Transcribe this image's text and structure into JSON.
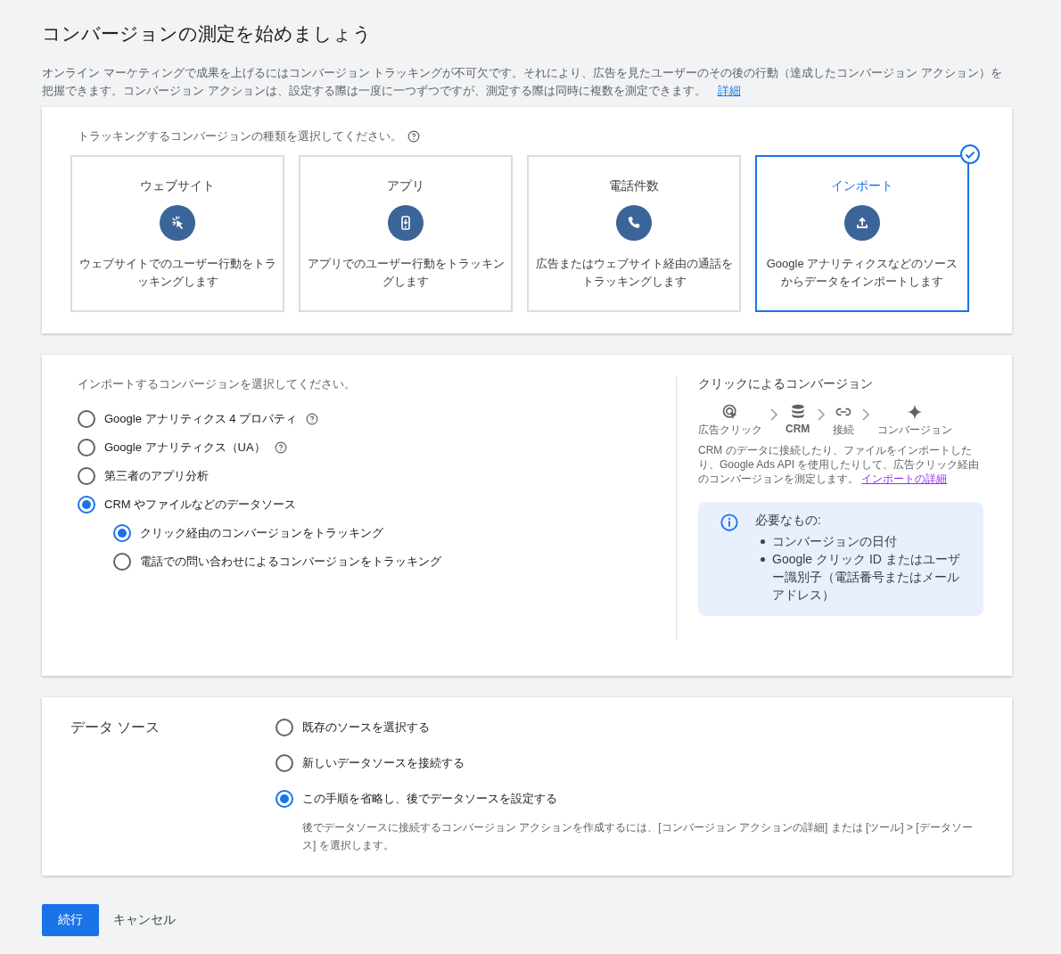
{
  "title": "コンバージョンの測定を始めましょう",
  "intro": {
    "text": "オンライン マーケティングで成果を上げるにはコンバージョン トラッキングが不可欠です。それにより、広告を見たユーザーのその後の行動（達成したコンバージョン アクション）を把握できます。コンバージョン アクションは、設定する際は一度に一つずつですが、測定する際は同時に複数を測定できます。",
    "link": "詳細"
  },
  "type_section": {
    "prompt": "トラッキングするコンバージョンの種類を選択してください。",
    "cards": [
      {
        "kind": "website",
        "title": "ウェブサイト",
        "description": "ウェブサイトでのユーザー行動をトラッキングします",
        "selected": false
      },
      {
        "kind": "app",
        "title": "アプリ",
        "description": "アプリでのユーザー行動をトラッキングします",
        "selected": false
      },
      {
        "kind": "phone",
        "title": "電話件数",
        "description": "広告またはウェブサイト経由の通話をトラッキングします",
        "selected": false
      },
      {
        "kind": "import",
        "title": "インポート",
        "description": "Google アナリティクスなどのソースからデータをインポートします",
        "selected": true
      }
    ]
  },
  "import_section": {
    "prompt": "インポートするコンバージョンを選択してください。",
    "options": [
      {
        "label": "Google アナリティクス 4 プロパティ",
        "help": true,
        "selected": false
      },
      {
        "label": "Google アナリティクス（UA）",
        "help": true,
        "selected": false
      },
      {
        "label": "第三者のアプリ分析",
        "help": false,
        "selected": false
      },
      {
        "label": "CRM やファイルなどのデータソース",
        "help": false,
        "selected": true,
        "children": [
          {
            "label": "クリック経由のコンバージョンをトラッキング",
            "help": false,
            "selected": true
          },
          {
            "label": "電話での問い合わせによるコンバージョンをトラッキング",
            "help": false,
            "selected": false
          }
        ]
      }
    ]
  },
  "flow": {
    "title": "クリックによるコンバージョン",
    "steps": [
      {
        "kind": "click",
        "label": "広告クリック"
      },
      {
        "kind": "database",
        "label": "CRM"
      },
      {
        "kind": "link",
        "label": "接続"
      },
      {
        "kind": "sparkle",
        "label": "コンバージョン"
      }
    ],
    "description": "CRM のデータに接続したり、ファイルをインポートしたり、Google Ads API を使用したりして、広告クリック経由のコンバージョンを測定します。",
    "link": "インポートの詳細",
    "requirements": {
      "title": "必要なもの:",
      "items": [
        "コンバージョンの日付",
        "Google クリック ID またはユーザー識別子（電話番号またはメールアドレス）"
      ]
    }
  },
  "data_source": {
    "label": "データ ソース",
    "options": [
      {
        "label": "既存のソースを選択する",
        "selected": false
      },
      {
        "label": "新しいデータソースを接続する",
        "selected": false
      },
      {
        "label": "この手順を省略し、後でデータソースを設定する",
        "selected": true,
        "note": "後でデータソースに接続するコンバージョン アクションを作成するには、[コンバージョン アクションの詳細] または [ツール] > [データソース] を選択します。"
      }
    ]
  },
  "buttons": [
    {
      "kind": "primary",
      "label": "続行"
    },
    {
      "kind": "text",
      "label": "キャンセル"
    }
  ]
}
